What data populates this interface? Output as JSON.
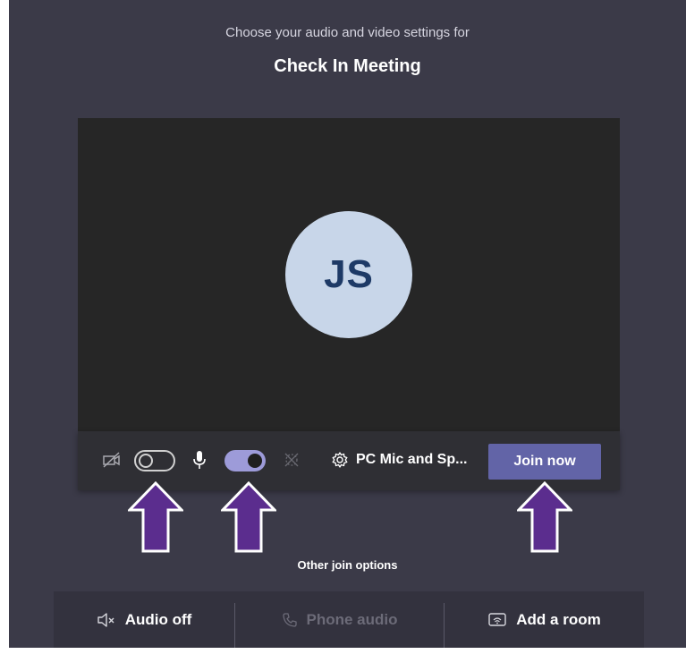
{
  "header": {
    "subtitle": "Choose your audio and video settings for",
    "meeting_title": "Check In Meeting"
  },
  "preview": {
    "avatar_initials": "JS"
  },
  "controls": {
    "camera_toggle_state": "off",
    "microphone_toggle_state": "on",
    "device_label": "PC Mic and Sp...",
    "join_label": "Join now"
  },
  "other_options": {
    "heading": "Other join options",
    "items": [
      {
        "label": "Audio off",
        "icon": "speaker-muted-icon",
        "enabled": true
      },
      {
        "label": "Phone audio",
        "icon": "phone-icon",
        "enabled": false
      },
      {
        "label": "Add a room",
        "icon": "cast-room-icon",
        "enabled": true
      }
    ]
  },
  "annotations": {
    "arrow_color": "#5b2d8e",
    "arrow_count": 3
  },
  "colors": {
    "background": "#3b3a48",
    "accent": "#6264a7",
    "toggle_on": "#9d9bd9",
    "avatar_bg": "#c8d6e9",
    "avatar_text": "#1e3a66"
  }
}
